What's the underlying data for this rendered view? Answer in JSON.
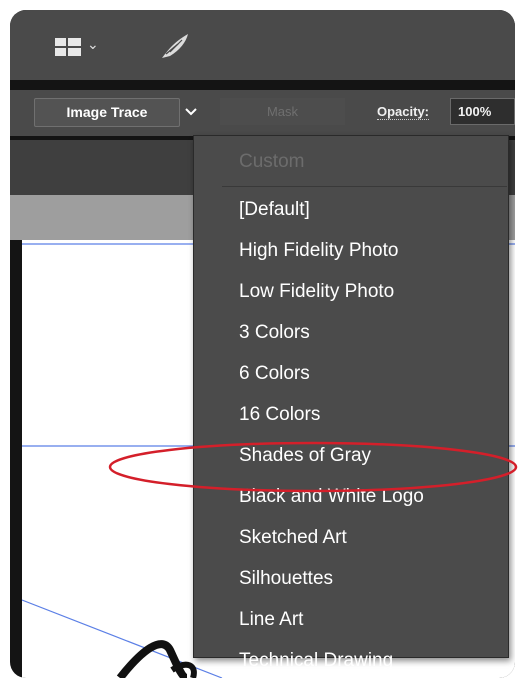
{
  "control_bar": {
    "image_trace_label": "Image Trace",
    "mask_label": "Mask",
    "opacity_label": "Opacity:",
    "opacity_value": "100%"
  },
  "preset_menu": {
    "custom_label": "Custom",
    "items": [
      "[Default]",
      "High Fidelity Photo",
      "Low Fidelity Photo",
      "3 Colors",
      "6 Colors",
      "16 Colors",
      "Shades of Gray",
      "Black and White Logo",
      "Sketched Art",
      "Silhouettes",
      "Line Art",
      "Technical Drawing"
    ],
    "highlighted_item": "Black and White Logo"
  },
  "colors": {
    "panel_bg": "#4a4a4a",
    "menu_bg": "#4b4b4b",
    "highlight_ring": "#d41f2a",
    "guide_line": "#5b7fe6"
  },
  "icons": {
    "workspace": "workspace-grid-icon",
    "chevron": "chevron-down-icon",
    "brush": "brush-feather-icon"
  }
}
